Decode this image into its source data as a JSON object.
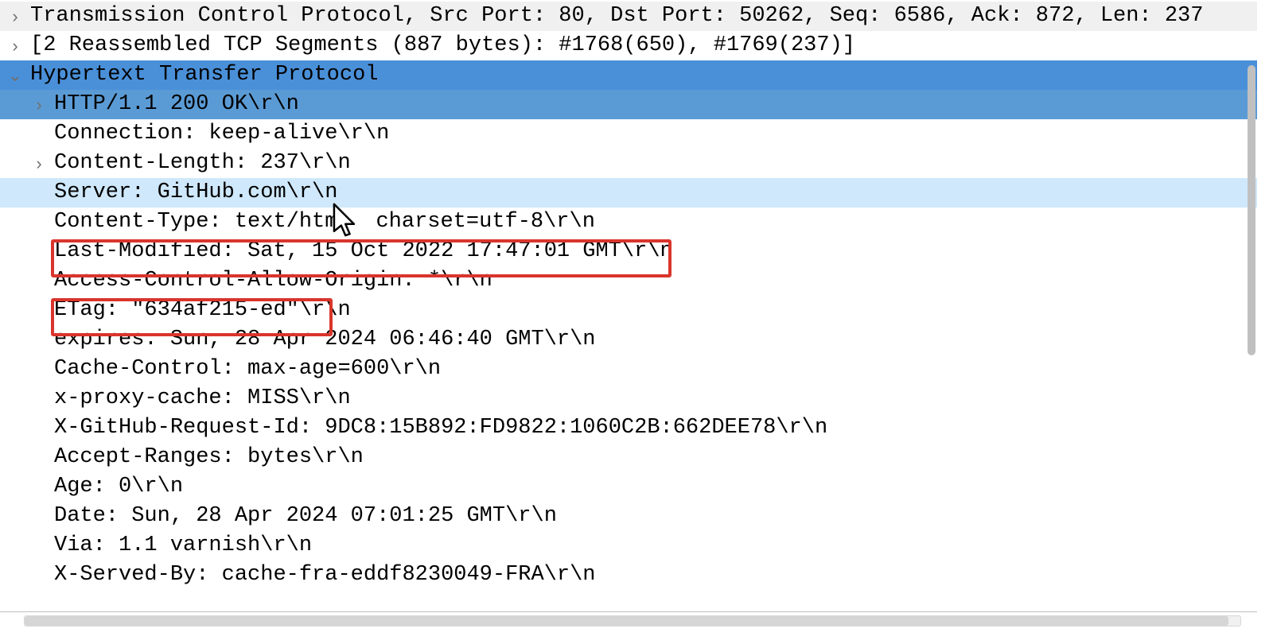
{
  "tree": {
    "tcp_summary": "Transmission Control Protocol, Src Port: 80, Dst Port: 50262, Seq: 6586, Ack: 872, Len: 237",
    "reassembled": "[2 Reassembled TCP Segments (887 bytes): #1768(650), #1769(237)]",
    "http_label": "Hypertext Transfer Protocol",
    "http": {
      "status": "HTTP/1.1 200 OK\\r\\n",
      "connection": "Connection: keep-alive\\r\\n",
      "content_length": "Content-Length: 237\\r\\n",
      "server": "Server: GitHub.com\\r\\n",
      "content_type_a": "Content-Type: text/htm",
      "content_type_b": "charset=utf-8\\r\\n",
      "last_modified": "Last-Modified: Sat, 15 Oct 2022 17:47:01 GMT\\r\\n",
      "acao": "Access-Control-Allow-Origin: *\\r\\n",
      "etag": "ETag: \"634af215-ed\"\\r\\n",
      "expires": "expires: Sun, 28 Apr 2024 06:46:40 GMT\\r\\n",
      "cache_control": "Cache-Control: max-age=600\\r\\n",
      "x_proxy_cache": "x-proxy-cache: MISS\\r\\n",
      "x_github_request_id": "X-GitHub-Request-Id: 9DC8:15B892:FD9822:1060C2B:662DEE78\\r\\n",
      "accept_ranges": "Accept-Ranges: bytes\\r\\n",
      "age": "Age: 0\\r\\n",
      "date": "Date: Sun, 28 Apr 2024 07:01:25 GMT\\r\\n",
      "via": "Via: 1.1 varnish\\r\\n",
      "x_served_by": "X-Served-By: cache-fra-eddf8230049-FRA\\r\\n"
    }
  },
  "carets": {
    "collapsed": "›",
    "expanded": "⌄"
  }
}
